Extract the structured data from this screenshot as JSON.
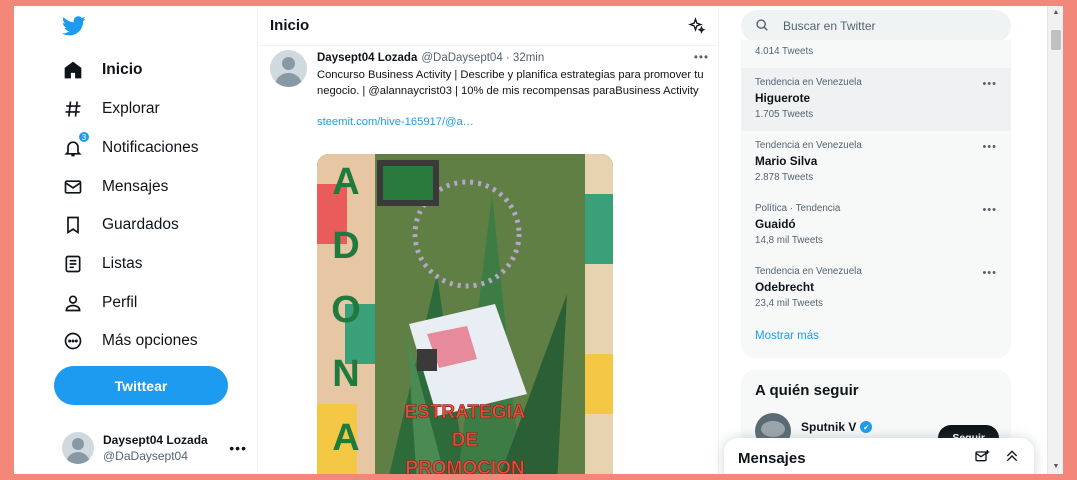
{
  "nav": {
    "items": [
      {
        "label": "Inicio",
        "icon": "home-icon"
      },
      {
        "label": "Explorar",
        "icon": "hashtag-icon"
      },
      {
        "label": "Notificaciones",
        "icon": "bell-icon",
        "badge": "3"
      },
      {
        "label": "Mensajes",
        "icon": "envelope-icon"
      },
      {
        "label": "Guardados",
        "icon": "bookmark-icon"
      },
      {
        "label": "Listas",
        "icon": "list-icon"
      },
      {
        "label": "Perfil",
        "icon": "person-icon"
      },
      {
        "label": "Más opciones",
        "icon": "more-circle-icon"
      }
    ],
    "tweet_button": "Twittear",
    "account": {
      "name": "Daysept04 Lozada",
      "handle": "@DaDaysept04"
    }
  },
  "timeline": {
    "title": "Inicio",
    "tweet": {
      "name": "Daysept04 Lozada",
      "handle": "@DaDaysept04 · 32min",
      "text": "Concurso Business Activity | Describe y planifica estrategias para promover tu negocio. | @alannaycrist03 | 10% de mis recompensas paraBusiness Activity",
      "link": "steemit.com/hive-165917/@a…",
      "media": {
        "side_letters": [
          "A",
          "D",
          "O",
          "N",
          "A"
        ],
        "caption_lines": [
          "ESTRATEGIA",
          "DE",
          "PROMOCION"
        ]
      }
    }
  },
  "search": {
    "placeholder": "Buscar en Twitter"
  },
  "trends": {
    "top_count": "4.014 Tweets",
    "items": [
      {
        "category": "Tendencia en Venezuela",
        "name": "Higuerote",
        "count": "1.705 Tweets"
      },
      {
        "category": "Tendencia en Venezuela",
        "name": "Mario Silva",
        "count": "2.878 Tweets"
      },
      {
        "category": "Política · Tendencia",
        "name": "Guaidó",
        "count": "14,8 mil Tweets"
      },
      {
        "category": "Tendencia en Venezuela",
        "name": "Odebrecht",
        "count": "23,4 mil Tweets"
      }
    ],
    "show_more": "Mostrar más"
  },
  "who_to_follow": {
    "title": "A quién seguir",
    "account": {
      "name": "Sputnik V",
      "button": "Seguir"
    }
  },
  "messages": {
    "title": "Mensajes"
  },
  "colors": {
    "accent": "#1d9bf0",
    "frame": "#f2877a"
  }
}
